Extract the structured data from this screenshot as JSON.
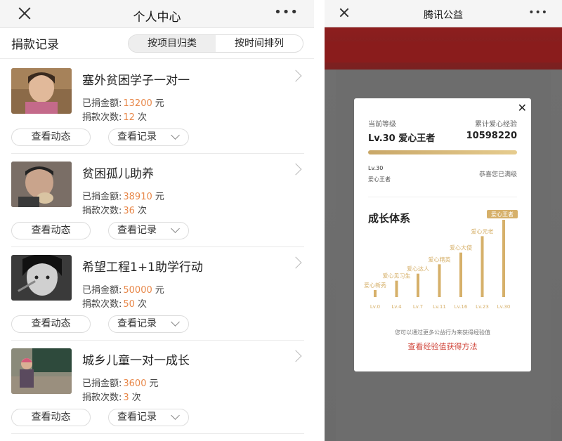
{
  "left": {
    "nav": {
      "title": "个人中心",
      "more": "•••"
    },
    "section_title": "捐款记录",
    "tabs": [
      "按项目归类",
      "按时间排列"
    ],
    "amount_label": "已捐金额:",
    "count_label": "捐款次数:",
    "amount_unit": "元",
    "count_unit": "次",
    "btn_news": "查看动态",
    "btn_records": "查看记录",
    "items": [
      {
        "title": "塞外贫困学子一对一",
        "amount": "13200",
        "count": "12"
      },
      {
        "title": "贫困孤儿助养",
        "amount": "38910",
        "count": "36"
      },
      {
        "title": "希望工程1+1助学行动",
        "amount": "50000",
        "count": "50"
      },
      {
        "title": "城乡儿童一对一成长",
        "amount": "3600",
        "count": "3"
      }
    ]
  },
  "right": {
    "nav": {
      "title": "腾讯公益",
      "more": "•••"
    },
    "modal": {
      "close": "✕",
      "current_level_label": "当前等级",
      "total_exp_label": "累计爱心经验",
      "level": "Lv.30 爱心王者",
      "exp": "10598220",
      "progress": 1.0,
      "small_level": "Lv.30",
      "small_name": "爱心王者",
      "max_text": "恭喜您已满级",
      "growth_title": "成长体系",
      "footer_text": "您可以通过更多公益行为来获得经验值",
      "footer_link": "查看经验值获得方法"
    }
  },
  "chart_data": {
    "type": "bar",
    "categories": [
      "Lv.0",
      "Lv.4",
      "Lv.7",
      "Lv.11",
      "Lv.16",
      "Lv.23",
      "Lv.30"
    ],
    "bar_labels": [
      "爱心新秀",
      "爱心见习生",
      "爱心达人",
      "爱心精英",
      "爱心大使",
      "爱心元老",
      "爱心王者"
    ],
    "values": [
      0,
      4,
      7,
      11,
      16,
      23,
      30
    ],
    "highlight": "爱心王者",
    "accent": "#d6b06a"
  }
}
